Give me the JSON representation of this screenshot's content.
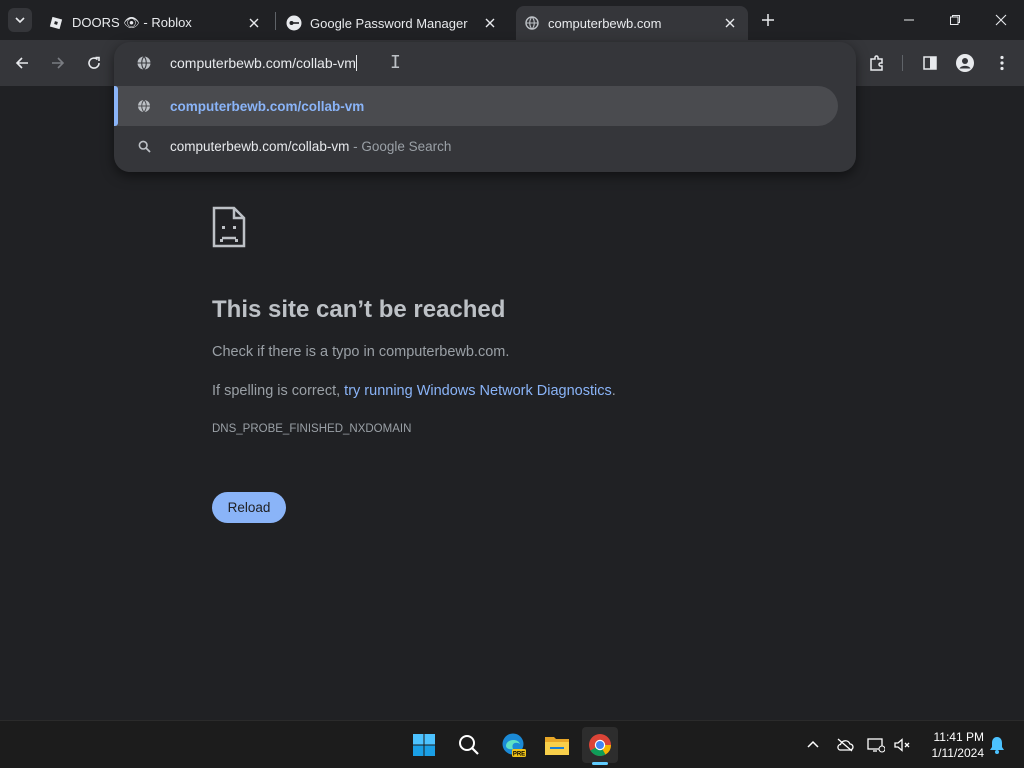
{
  "tabs": [
    {
      "title": "DOORS 👁 - Roblox",
      "favicon": "roblox-icon",
      "active": false
    },
    {
      "title": "Google Password Manager",
      "favicon": "key-icon",
      "active": false
    },
    {
      "title": "computerbewb.com",
      "favicon": "globe-icon",
      "active": true
    }
  ],
  "omnibox": {
    "value": "computerbewb.com/collab-vm",
    "suggestions": [
      {
        "text": "computerbewb.com/collab-vm",
        "suffix": "",
        "icon": "globe-icon"
      },
      {
        "text": "computerbewb.com/collab-vm",
        "suffix": " - Google Search",
        "icon": "search-icon"
      }
    ]
  },
  "error": {
    "title": "This site can’t be reached",
    "line1": "Check if there is a typo in computerbewb.com.",
    "line2_prefix": "If spelling is correct, ",
    "line2_link": "try running Windows Network Diagnostics",
    "line2_suffix": ".",
    "code": "DNS_PROBE_FINISHED_NXDOMAIN",
    "reload_label": "Reload"
  },
  "taskbar": {
    "time": "11:41 PM",
    "date": "1/11/2024"
  },
  "colors": {
    "accent": "#8ab4f8",
    "background": "#202124",
    "toolbar": "#35363a"
  }
}
